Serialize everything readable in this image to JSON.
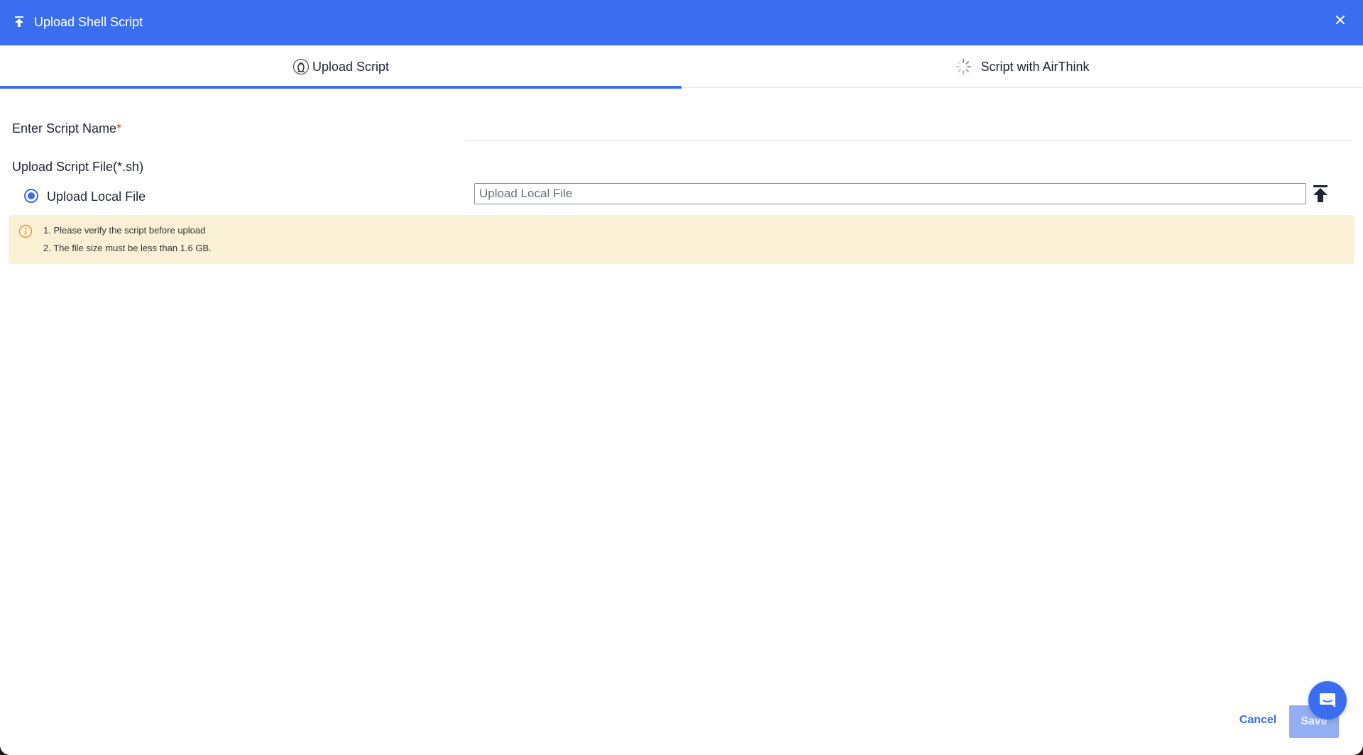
{
  "header": {
    "title": "Upload Shell Script",
    "icon": "upload-arrow-icon",
    "close_icon": "close-icon"
  },
  "tabs": [
    {
      "label": "Upload Script",
      "icon": "linux-penguin-icon",
      "active": true
    },
    {
      "label": "Script with AirThink",
      "icon": "spinner-icon",
      "active": false
    }
  ],
  "form": {
    "script_name_label": "Enter Script Name",
    "required_mark": "*",
    "script_name_value": "",
    "upload_file_label": "Upload Script File(*.sh)",
    "radio_label": "Upload Local File",
    "file_placeholder": "Upload Local File"
  },
  "notice": {
    "icon": "info-circle-icon",
    "lines": [
      "1. Please verify the script before upload",
      "2. The file size must be less than 1.6 GB."
    ]
  },
  "footer": {
    "cancel_label": "Cancel",
    "save_label": "Save"
  },
  "colors": {
    "primary": "#3a6df0",
    "notice_bg": "#faf0d4",
    "notice_icon": "#e8913a",
    "required": "#e53935"
  }
}
